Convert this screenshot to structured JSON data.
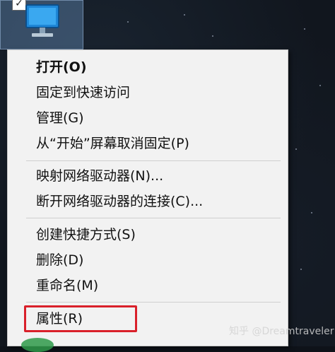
{
  "desktop": {
    "icon_name": "computer-icon",
    "checkbox_glyph": "✓"
  },
  "context_menu": {
    "items": [
      {
        "label": "打开(O)",
        "bold": true
      },
      {
        "label": "固定到快速访问"
      },
      {
        "label": "管理(G)"
      },
      {
        "label": "从“开始”屏幕取消固定(P)"
      },
      {
        "label": "映射网络驱动器(N)..."
      },
      {
        "label": "断开网络驱动器的连接(C)..."
      },
      {
        "label": "创建快捷方式(S)"
      },
      {
        "label": "删除(D)"
      },
      {
        "label": "重命名(M)"
      },
      {
        "label": "属性(R)"
      }
    ]
  },
  "annotation": {
    "color": "#d9202a"
  },
  "watermark": "知乎 @Dreamtraveler"
}
